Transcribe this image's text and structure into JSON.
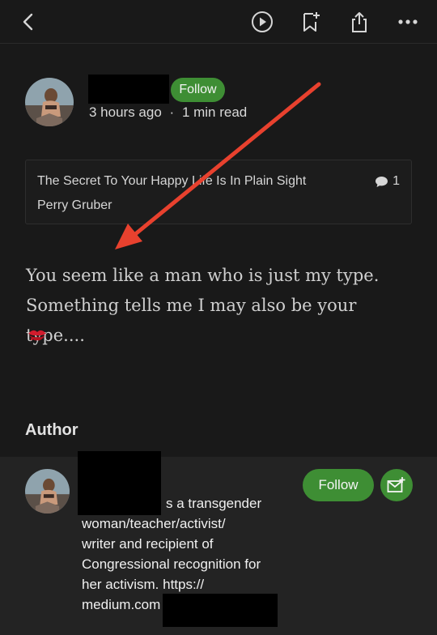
{
  "toolbar": {
    "icons": [
      "back-icon",
      "play-icon",
      "bookmark-add-icon",
      "share-icon",
      "more-icon"
    ]
  },
  "response_header": {
    "follow_label": "Follow",
    "time_ago": "3 hours ago",
    "separator": "·",
    "read_time": "1 min read"
  },
  "response_card": {
    "title": "The Secret To Your Happy Life Is In Plain Sight",
    "author": "Perry Gruber",
    "comment_count": "1"
  },
  "body": {
    "line1": "You seem like a man who is just my type.",
    "line2": "Something tells me I may also be your type....",
    "emoji": "💋"
  },
  "author_section": {
    "heading": "Author",
    "follow_label": "Follow",
    "bio_lines": [
      "s a transgender",
      "woman/teacher/activist/",
      "writer and recipient of",
      "Congressional recognition for",
      "her activism. https://",
      "medium.com"
    ]
  },
  "colors": {
    "background": "#191919",
    "accent_green": "#3e8e34",
    "arrow_red": "#e8412e"
  }
}
